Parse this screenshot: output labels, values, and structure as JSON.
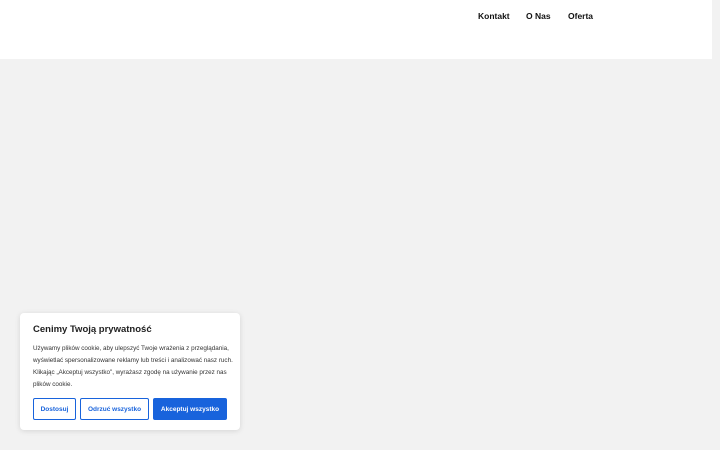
{
  "nav": {
    "items": [
      "Kontakt",
      "O Nas",
      "Oferta"
    ]
  },
  "cookie": {
    "title": "Cenimy Twoją prywatność",
    "text": "Używamy plików cookie, aby ulepszyć Twoje wrażenia z przeglądania, wyświetlać spersonalizowane reklamy lub treści i analizować nasz ruch. Klikając „Akceptuj wszystko\", wyrażasz zgodę na używanie przez nas plików cookie.",
    "customize_label": "Dostosuj",
    "reject_label": "Odrzuć wszystko",
    "accept_label": "Akceptuj wszystko",
    "accent_color": "#1863dc"
  }
}
